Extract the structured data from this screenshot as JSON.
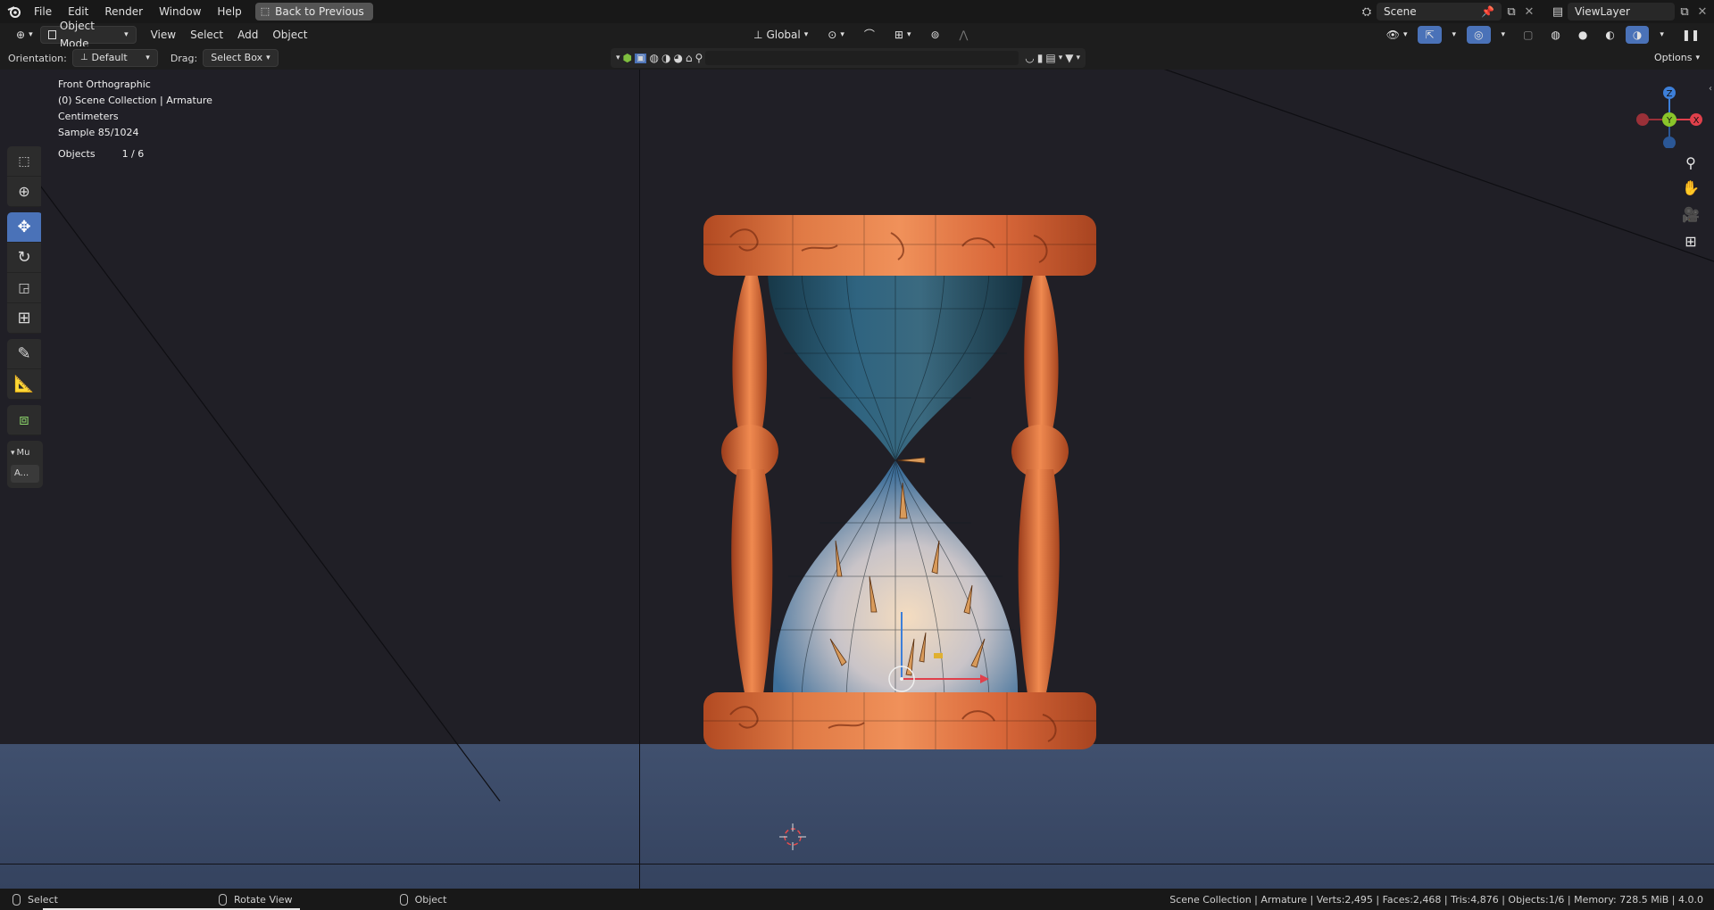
{
  "menubar": {
    "items": [
      "File",
      "Edit",
      "Render",
      "Window",
      "Help"
    ],
    "back_button": "Back to Previous",
    "scene": "Scene",
    "view_layer": "ViewLayer"
  },
  "header": {
    "mode": "Object Mode",
    "menus": [
      "View",
      "Select",
      "Add",
      "Object"
    ],
    "transform_orientation": "Global"
  },
  "tool_settings": {
    "orientation_label": "Orientation:",
    "orientation_value": "Default",
    "drag_label": "Drag:",
    "drag_value": "Select Box",
    "search_placeholder": "",
    "options_label": "Options"
  },
  "viewport": {
    "info_lines": [
      "Front Orthographic",
      "(0) Scene Collection | Armature",
      "Centimeters",
      "Sample 85/1024"
    ],
    "objects_label": "Objects",
    "objects_value": "1 / 6",
    "panel_label": "Mu",
    "panel_button": "A..."
  },
  "gizmo": {
    "z": "Z",
    "y": "Y",
    "x": "X"
  },
  "statusbar": {
    "select": "Select",
    "rotate_view": "Rotate View",
    "object": "Object",
    "stats": "Scene Collection | Armature | Verts:2,495 | Faces:2,468 | Tris:4,876 | Objects:1/6 | Memory: 728.5 MiB | 4.0.0"
  },
  "colors": {
    "accent": "#4a72b8",
    "wood": "#d96a3a",
    "glass": "#2f5c74",
    "sand": "#e8c9a8",
    "gizmo_x": "#e0404b",
    "gizmo_y": "#8ac42a",
    "gizmo_z": "#3d7fd9"
  }
}
